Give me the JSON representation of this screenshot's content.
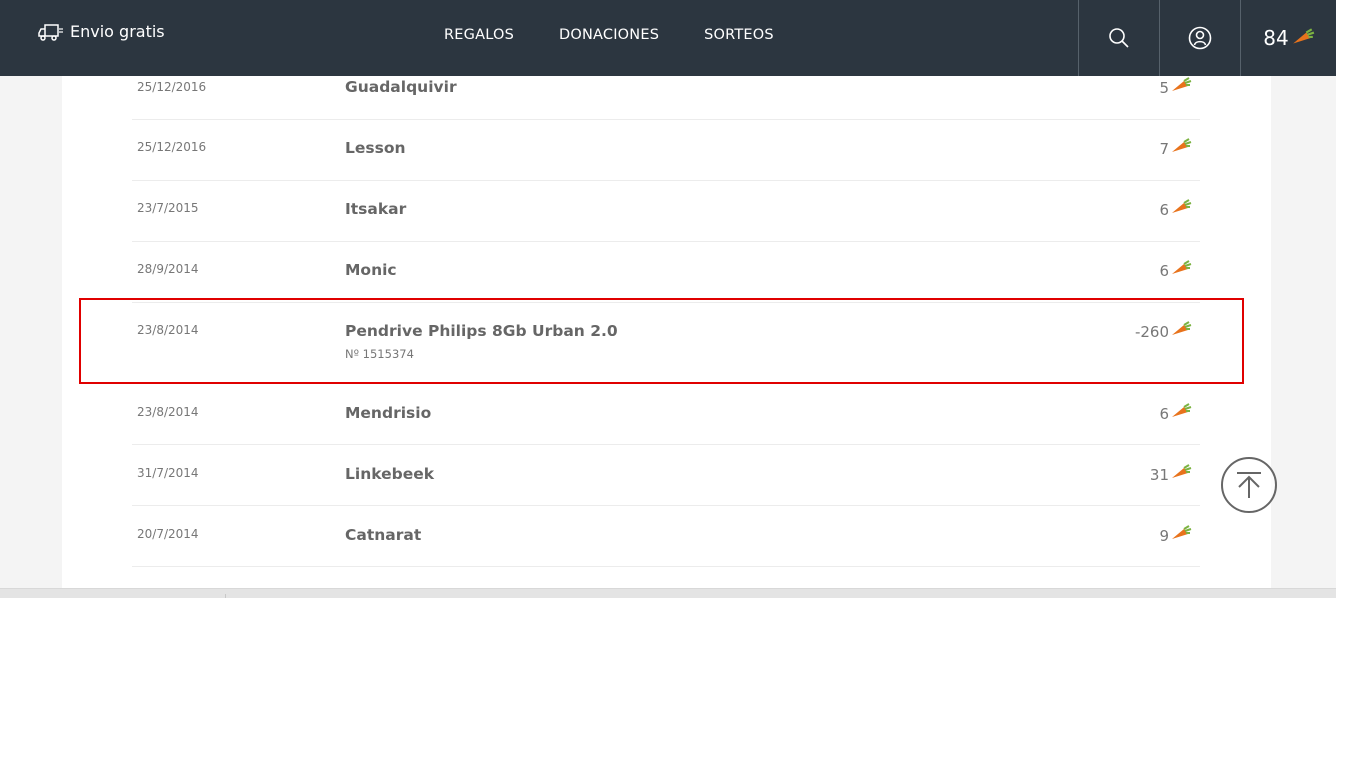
{
  "header": {
    "shipping_label": "Envio gratis",
    "nav": [
      "REGALOS",
      "DONACIONES",
      "SORTEOS"
    ],
    "points": "84",
    "icons": {
      "shipping": "delivery-truck-icon",
      "search": "search-icon",
      "user": "user-account-icon",
      "points": "carrot-points-icon"
    }
  },
  "rows": [
    {
      "date": "25/12/2016",
      "title": "Guadalquivir",
      "sub": "",
      "points": "5"
    },
    {
      "date": "25/12/2016",
      "title": "Lesson",
      "sub": "",
      "points": "7"
    },
    {
      "date": "23/7/2015",
      "title": "Itsakar",
      "sub": "",
      "points": "6"
    },
    {
      "date": "28/9/2014",
      "title": "Monic",
      "sub": "",
      "points": "6"
    },
    {
      "date": "23/8/2014",
      "title": "Pendrive Philips 8Gb Urban 2.0",
      "sub": "Nº 1515374",
      "points": "-260"
    },
    {
      "date": "23/8/2014",
      "title": "Mendrisio",
      "sub": "",
      "points": "6"
    },
    {
      "date": "31/7/2014",
      "title": "Linkebeek",
      "sub": "",
      "points": "31"
    },
    {
      "date": "20/7/2014",
      "title": "Catnarat",
      "sub": "",
      "points": "9"
    }
  ],
  "colors": {
    "header_bg": "#2c3640",
    "highlight": "#e00000",
    "carrot_orange": "#e8731c",
    "carrot_green": "#7cb342"
  }
}
